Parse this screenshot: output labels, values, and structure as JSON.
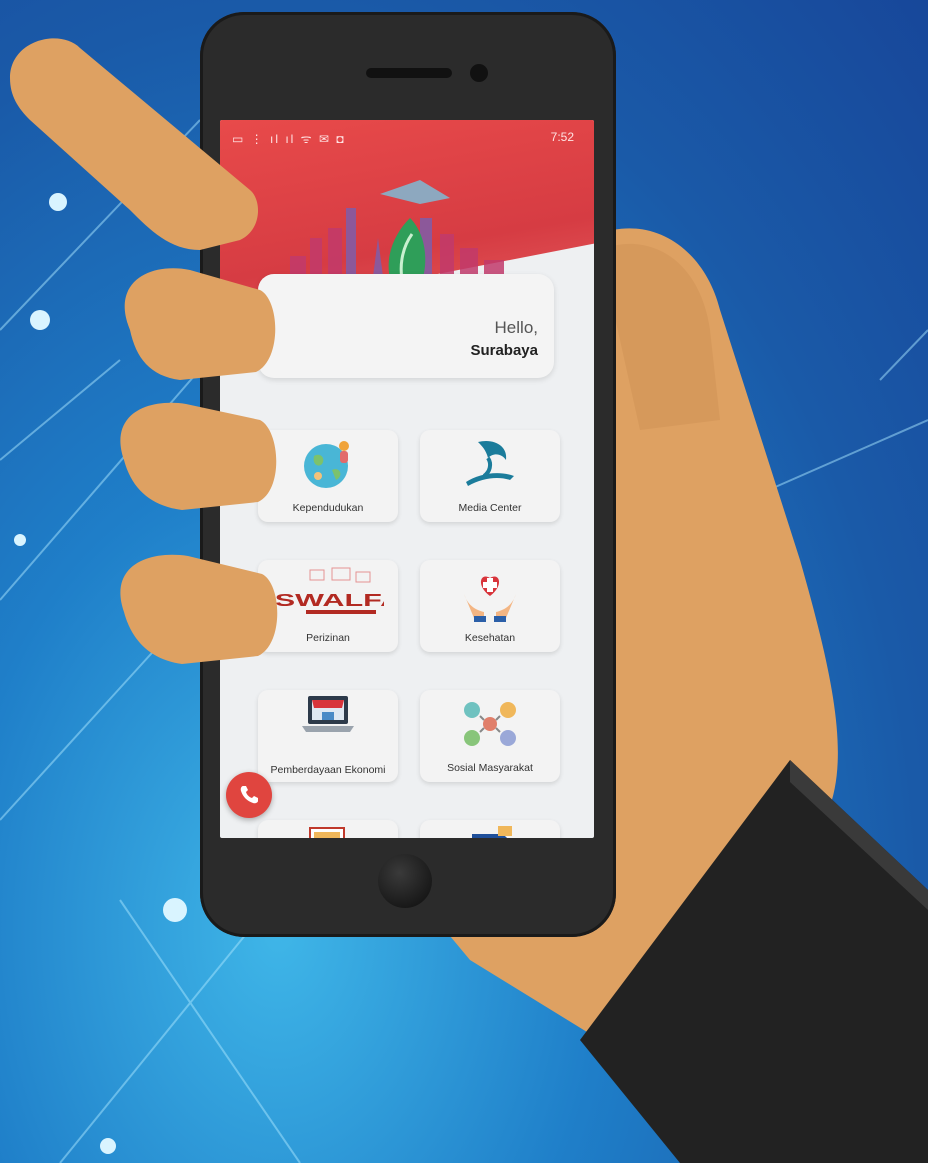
{
  "status_bar": {
    "time": "7:52",
    "icons": "▭ ⋮ ıl ıl ᯤ ✉ ◘"
  },
  "greeting": {
    "hello": "Hello,",
    "city": "Surabaya"
  },
  "menu": [
    {
      "label": "Media Center",
      "icon": "shark-crocodile-icon"
    },
    {
      "label": "Kependudukan",
      "icon": "globe-people-icon"
    },
    {
      "label": "Kesehatan",
      "icon": "heart-hands-icon"
    },
    {
      "label": "Perizinan",
      "icon": "sswalfa-logo-icon",
      "logo_text": "SSWALFA"
    },
    {
      "label": "Sosial Masyarakat",
      "icon": "community-icon"
    },
    {
      "label": "Pemberdayaan Ekonomi",
      "icon": "laptop-store-icon"
    }
  ],
  "colors": {
    "brand_red": "#e84a4a",
    "sky_blue": "#1f7fc9",
    "skin": "#dea162",
    "sleeve": "#222222"
  }
}
